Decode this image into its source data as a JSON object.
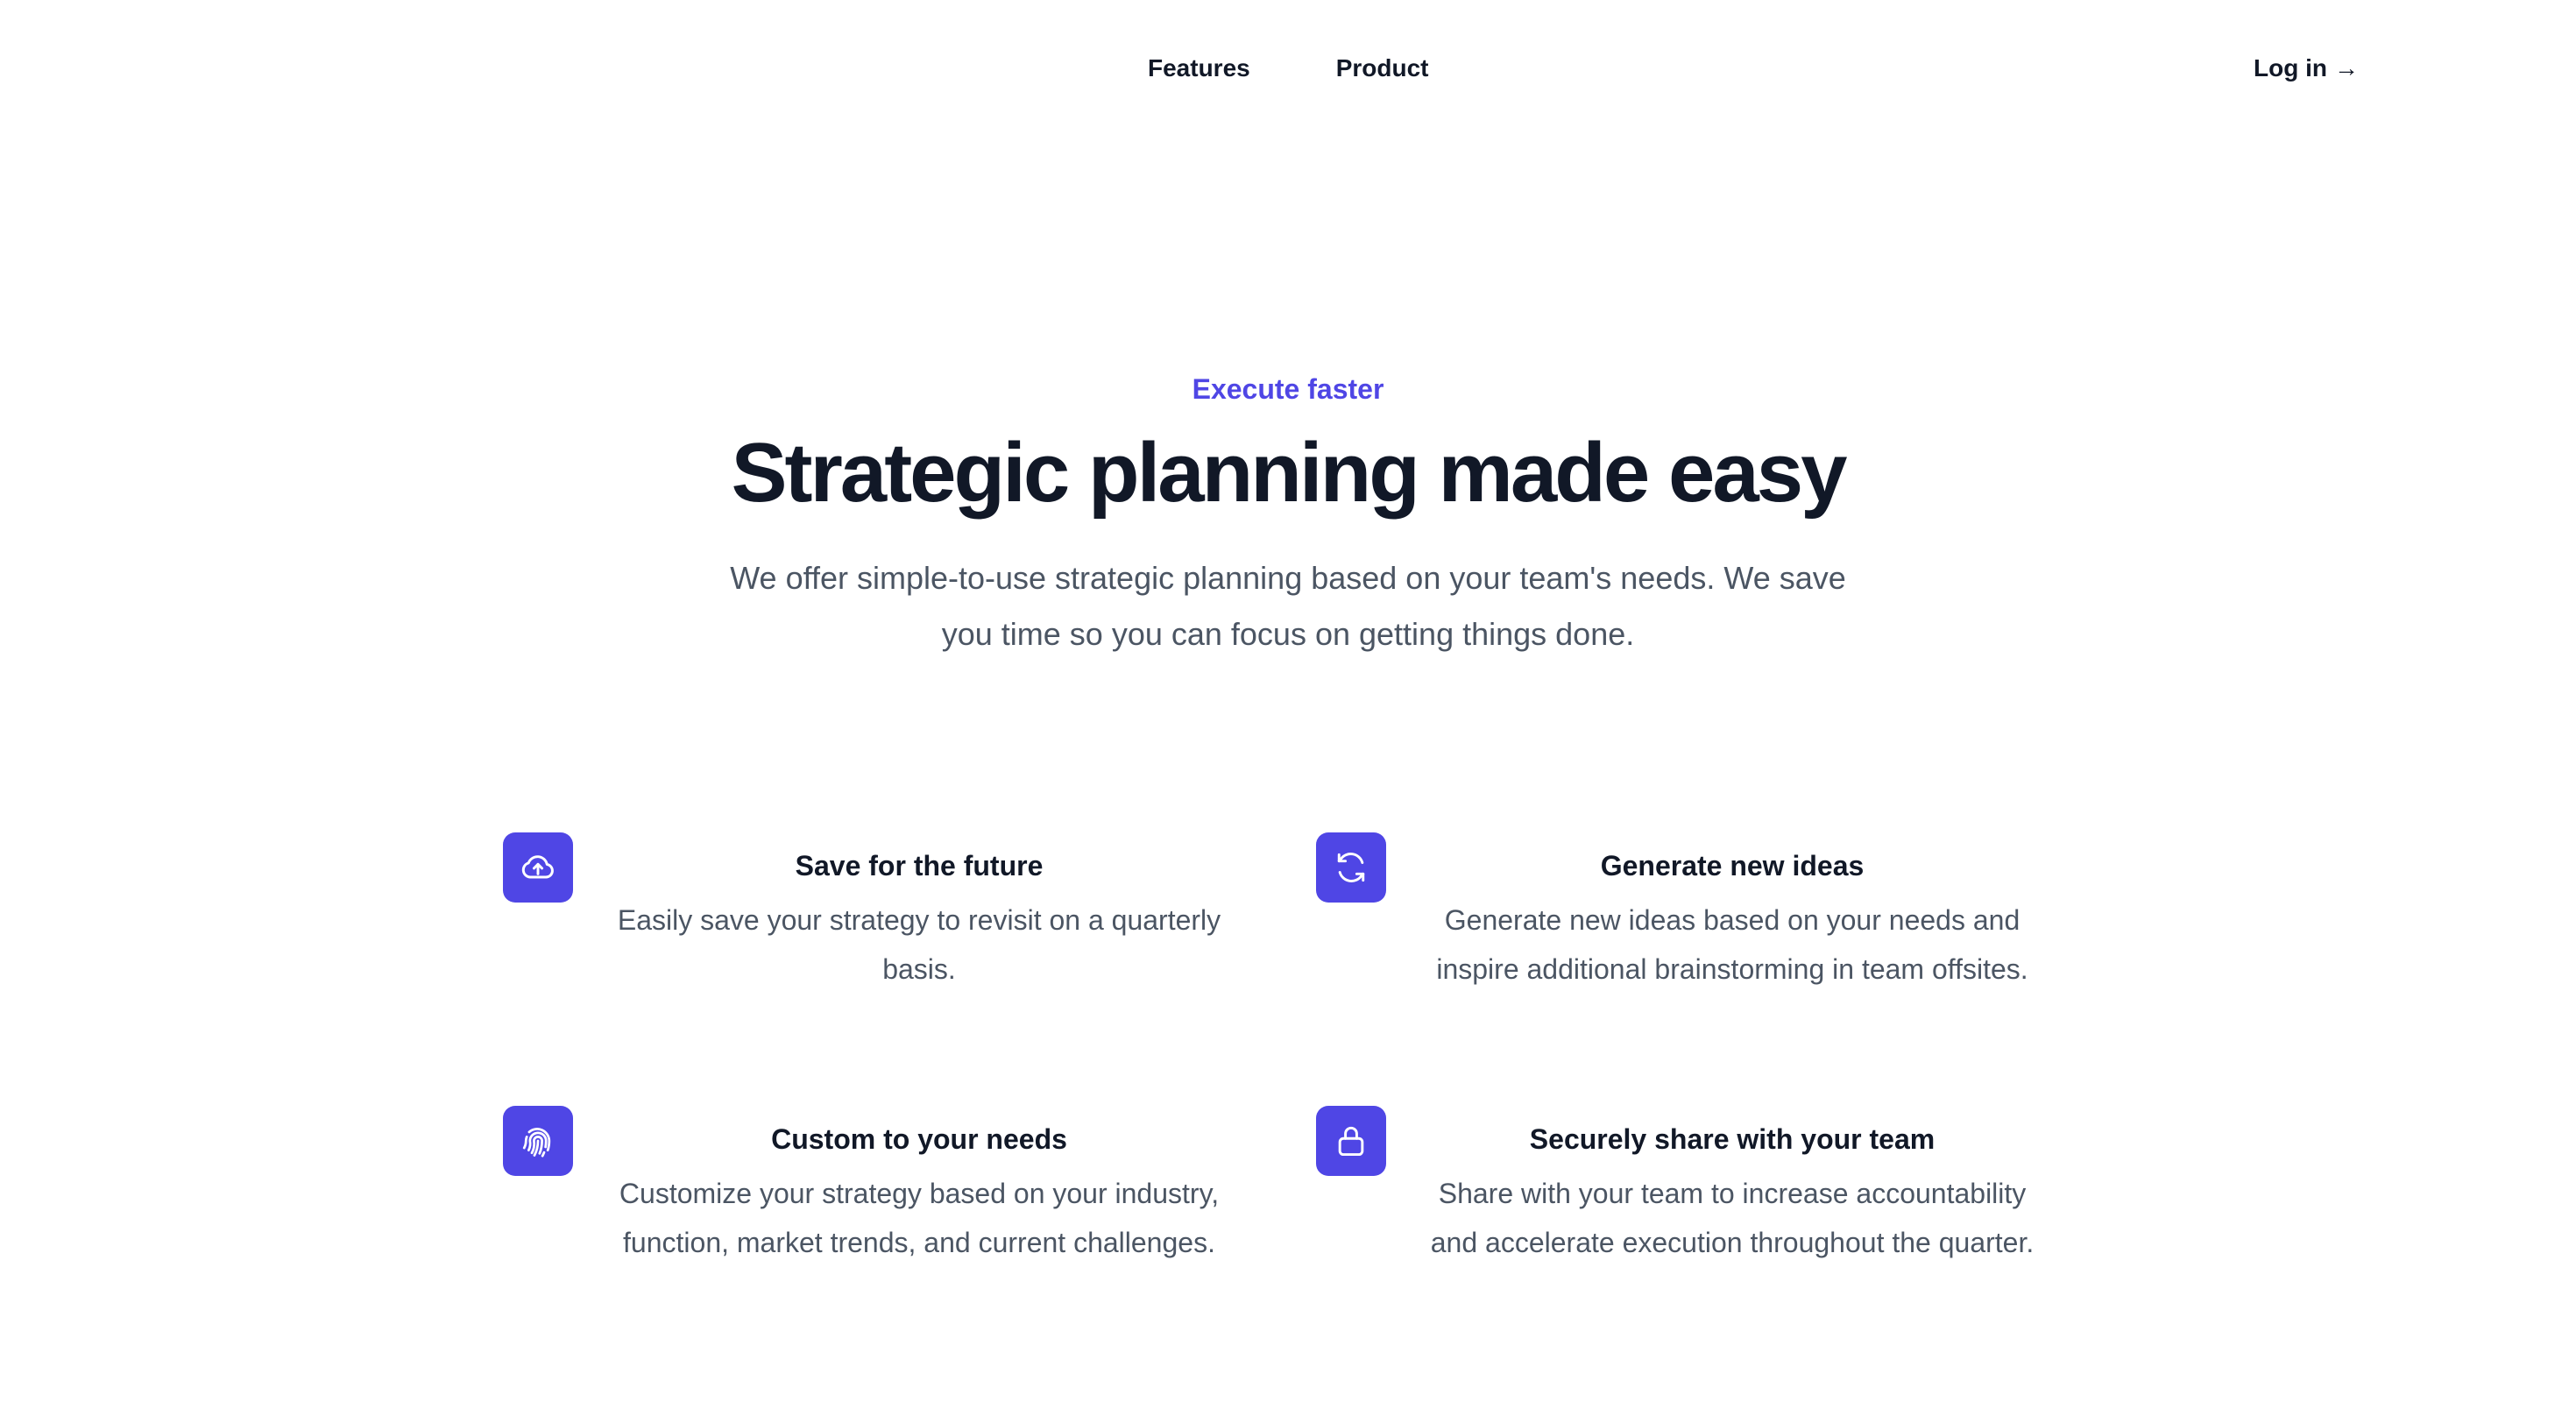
{
  "nav": {
    "links": [
      "Features",
      "Product"
    ],
    "login_label": "Log in",
    "login_arrow": "→"
  },
  "hero": {
    "eyebrow": "Execute faster",
    "title": "Strategic planning made easy",
    "subtitle": "We offer simple-to-use strategic planning based on your team's needs. We save you time so you can focus on getting things done."
  },
  "features": [
    {
      "icon": "cloud-upload-icon",
      "title": "Save for the future",
      "description": "Easily save your strategy to revisit on a quarterly basis."
    },
    {
      "icon": "refresh-icon",
      "title": "Generate new ideas",
      "description": "Generate new ideas based on your needs and inspire additional brainstorming in team offsites."
    },
    {
      "icon": "fingerprint-icon",
      "title": "Custom to your needs",
      "description": "Customize your strategy based on your industry, function, market trends, and current challenges."
    },
    {
      "icon": "lock-icon",
      "title": "Securely share with your team",
      "description": "Share with your team to increase accountability and accelerate execution throughout the quarter."
    }
  ],
  "colors": {
    "accent": "#4f46e5",
    "text_primary": "#111827",
    "text_secondary": "#4b5563",
    "background": "#ffffff"
  }
}
